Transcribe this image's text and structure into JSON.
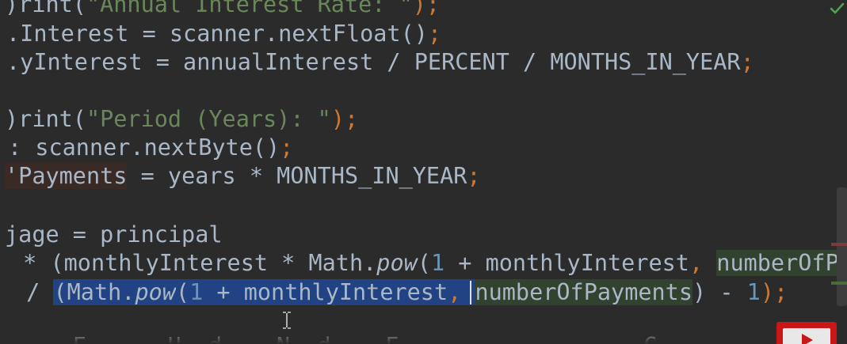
{
  "editor": {
    "lines": [
      {
        "segments": [
          {
            "text": ")rint(",
            "cls": ""
          },
          {
            "text": "\"Annual Interest Rate: \"",
            "cls": "str"
          },
          {
            "text": ");",
            "cls": "kw"
          }
        ]
      },
      {
        "segments": [
          {
            "text": ".Interest = scanner.nextFloat()",
            "cls": ""
          },
          {
            "text": ";",
            "cls": "kw"
          }
        ]
      },
      {
        "segments": [
          {
            "text": ".yInterest = annualInterest / PERCENT / MONTHS_IN_YEAR",
            "cls": ""
          },
          {
            "text": ";",
            "cls": "kw"
          }
        ]
      },
      {
        "segments": []
      },
      {
        "segments": [
          {
            "text": ")rint(",
            "cls": ""
          },
          {
            "text": "\"Period (Years): \"",
            "cls": "str"
          },
          {
            "text": ");",
            "cls": "kw"
          }
        ]
      },
      {
        "segments": [
          {
            "text": ": scanner.nextByte()",
            "cls": ""
          },
          {
            "text": ";",
            "cls": "kw"
          }
        ]
      },
      {
        "segments": [
          {
            "text": "'Payments",
            "cls": "var-bg"
          },
          {
            "text": " = years * MONTHS_IN_YEAR",
            "cls": ""
          },
          {
            "text": ";",
            "cls": "kw"
          }
        ]
      },
      {
        "segments": []
      },
      {
        "segments": [
          {
            "text": "jage = principal",
            "cls": ""
          }
        ]
      },
      {
        "segments": [
          {
            "text": " * (monthlyInterest * Math.",
            "cls": ""
          },
          {
            "text": "pow",
            "cls": "italic"
          },
          {
            "text": "(",
            "cls": ""
          },
          {
            "text": "1",
            "cls": "num"
          },
          {
            "text": " + monthlyInterest",
            "cls": ""
          },
          {
            "text": ", ",
            "cls": "kw"
          },
          {
            "text": "numberOfPa",
            "cls": "param-bg"
          }
        ]
      },
      {
        "segments": [
          {
            "text": " / ",
            "cls": ""
          },
          {
            "text": "(Math.",
            "cls": "sel"
          },
          {
            "text": "pow",
            "cls": "sel italic"
          },
          {
            "text": "(",
            "cls": "sel"
          },
          {
            "text": "1",
            "cls": "sel num"
          },
          {
            "text": " + monthlyInterest",
            "cls": "sel"
          },
          {
            "text": ", ",
            "cls": "sel kw"
          },
          {
            "text": "numberOfPayments",
            "cls": "param-bg"
          },
          {
            "text": ") - ",
            "cls": ""
          },
          {
            "text": "1",
            "cls": "num"
          },
          {
            "text": ");",
            "cls": "kw"
          }
        ]
      },
      {
        "segments": []
      },
      {
        "segments": [
          {
            "text": "   F      U  d    N  d    F                  C           I             ( )  f",
            "cls": ""
          }
        ]
      }
    ]
  },
  "colors": {
    "background": "#2b2b2b",
    "text": "#a9b7c6",
    "string": "#6a8759",
    "keyword": "#cc7832",
    "number": "#6897bb",
    "selection": "#214283"
  },
  "icons": {
    "inspection_status": "check-icon",
    "cursor": "ibeam-cursor-icon",
    "overlay": "play-icon"
  }
}
